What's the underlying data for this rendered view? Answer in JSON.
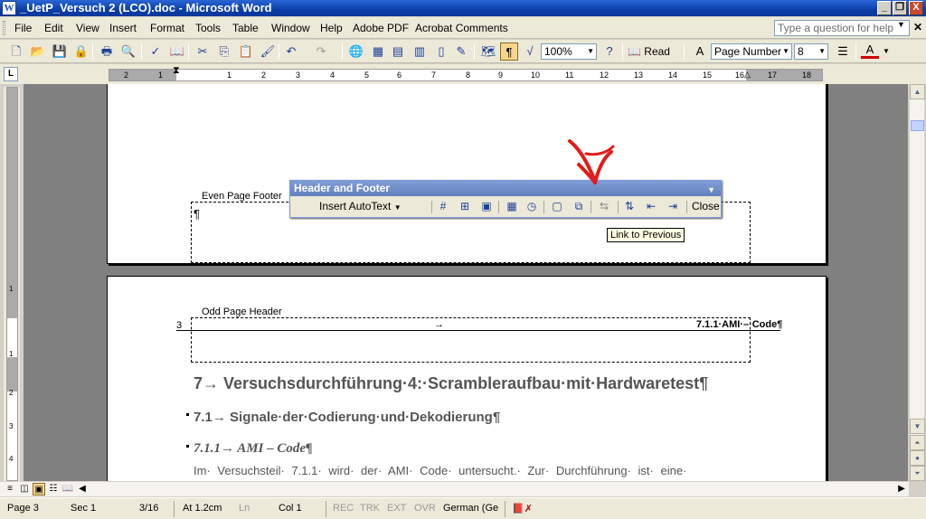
{
  "window": {
    "title": "_UetP_Versuch 2 (LCO).doc - Microsoft Word",
    "minimize": "_",
    "restore": "❐",
    "close": "X"
  },
  "menu": {
    "items": [
      "File",
      "Edit",
      "View",
      "Insert",
      "Format",
      "Tools",
      "Table",
      "Window",
      "Help",
      "Adobe PDF",
      "Acrobat Comments"
    ],
    "help_placeholder": "Type a question for help"
  },
  "toolbar": {
    "zoom": "100%",
    "read_label": "Read",
    "style": "Page Number",
    "font_size": "8"
  },
  "ruler": {
    "numbers": [
      "2",
      "1",
      "1",
      "2",
      "3",
      "4",
      "5",
      "6",
      "7",
      "8",
      "9",
      "10",
      "11",
      "12",
      "13",
      "14",
      "15",
      "16",
      "17",
      "18"
    ],
    "vertical_numbers": [
      "1",
      "1",
      "2",
      "3",
      "4"
    ]
  },
  "document": {
    "even_footer_label": "Even Page Footer",
    "odd_header_label": "Odd Page Header",
    "header_page_number": "3",
    "header_arrow": "→",
    "header_right_text": "7.1.1·AMI·–·Code¶",
    "pilcrow": "¶",
    "heading1": "7→ Versuchsdurchführung·4:·Scrambleraufbau·mit·Hardwaretest¶",
    "heading2": "7.1→ Signale·der·Codierung·und·Dekodierung¶",
    "heading3": "7.1.1→ AMI – Code¶",
    "paragraph": "Im· Versuchsteil· 7.1.1· wird· der· AMI· Code· untersucht.· Zur· Durchführung· ist· eine·"
  },
  "hf_toolbar": {
    "title": "Header and Footer",
    "insert_autotext": "Insert AutoText",
    "close": "Close",
    "tooltip": "Link to Previous"
  },
  "status": {
    "page": "Page 3",
    "sec": "Sec  1",
    "pages": "3/16",
    "at": "At  1.2cm",
    "ln": "Ln",
    "col": "Col  1",
    "rec": "REC",
    "trk": "TRK",
    "ext": "EXT",
    "ovr": "OVR",
    "language": "German (Ge"
  }
}
